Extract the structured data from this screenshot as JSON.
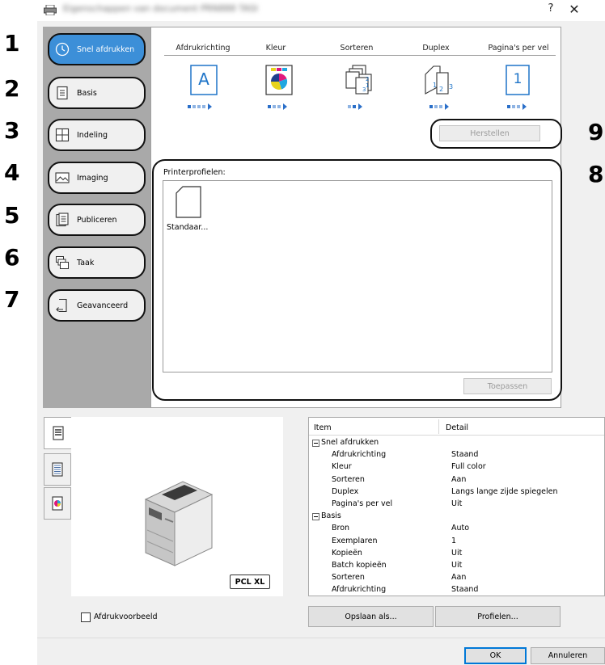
{
  "window": {
    "title": "Eigenschappen van document PRN888 TASK-5C",
    "help_label": "?",
    "close_label": "✕"
  },
  "nav": {
    "items": [
      {
        "number": "1",
        "label": "Snel afdrukken",
        "icon": "clock-icon"
      },
      {
        "number": "2",
        "label": "Basis",
        "icon": "document-icon"
      },
      {
        "number": "3",
        "label": "Indeling",
        "icon": "layout-grid-icon"
      },
      {
        "number": "4",
        "label": "Imaging",
        "icon": "image-icon"
      },
      {
        "number": "5",
        "label": "Publiceren",
        "icon": "booklet-icon"
      },
      {
        "number": "6",
        "label": "Taak",
        "icon": "stacked-pages-icon"
      },
      {
        "number": "7",
        "label": "Geavanceerd",
        "icon": "advanced-arrow-icon"
      }
    ],
    "active_index": 0
  },
  "quick_print": {
    "columns": [
      "Afdrukrichting",
      "Kleur",
      "Sorteren",
      "Duplex",
      "Pagina's per vel"
    ],
    "icons": [
      "orientation-a-icon",
      "color-icon",
      "collate-icon",
      "duplex-icon",
      "pages-per-sheet-icon"
    ],
    "orientation_letter": "A",
    "pages_per_sheet_value": "1",
    "reset_button": "Herstellen",
    "callout_reset": "9",
    "callout_profiles": "8"
  },
  "profiles": {
    "label": "Printerprofielen:",
    "items": [
      {
        "label": "Standaar..."
      }
    ],
    "apply_button": "Toepassen"
  },
  "preview": {
    "badge": "PCL XL",
    "checkbox_label": "Afdrukvoorbeeld",
    "checkbox_checked": false,
    "tabs": [
      "printer-tab-icon",
      "page-tab-icon",
      "color-tab-icon"
    ]
  },
  "settings": {
    "header_item": "Item",
    "header_detail": "Detail",
    "rows": [
      {
        "type": "group",
        "item": "Snel afdrukken",
        "detail": ""
      },
      {
        "type": "row",
        "item": "Afdrukrichting",
        "detail": "Staand"
      },
      {
        "type": "row",
        "item": "Kleur",
        "detail": "Full color"
      },
      {
        "type": "row",
        "item": "Sorteren",
        "detail": "Aan"
      },
      {
        "type": "row",
        "item": "Duplex",
        "detail": "Langs lange zijde spiegelen"
      },
      {
        "type": "row",
        "item": "Pagina's per vel",
        "detail": "Uit"
      },
      {
        "type": "group",
        "item": "Basis",
        "detail": ""
      },
      {
        "type": "row",
        "item": "Bron",
        "detail": "Auto"
      },
      {
        "type": "row",
        "item": "Exemplaren",
        "detail": "1"
      },
      {
        "type": "row",
        "item": "Kopieën",
        "detail": "Uit"
      },
      {
        "type": "row",
        "item": "Batch kopieën",
        "detail": "Uit"
      },
      {
        "type": "row",
        "item": "Sorteren",
        "detail": "Aan"
      },
      {
        "type": "row",
        "item": "Afdrukrichting",
        "detail": "Staand"
      }
    ]
  },
  "buttons": {
    "save_as": "Opslaan als...",
    "profiles": "Profielen...",
    "ok": "OK",
    "cancel": "Annuleren"
  }
}
